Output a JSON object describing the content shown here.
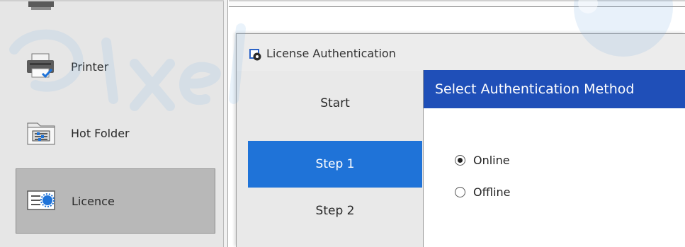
{
  "sidebar": {
    "items": [
      {
        "label": "Printer",
        "icon": "printer-icon"
      },
      {
        "label": "Hot Folder",
        "icon": "hot-folder-icon"
      },
      {
        "label": "Licence",
        "icon": "licence-icon",
        "selected": true
      }
    ]
  },
  "dialog": {
    "title": "License Authentication",
    "title_icon": "license-settings-icon",
    "steps": [
      {
        "label": "Start",
        "active": false
      },
      {
        "label": "Step 1",
        "active": true
      },
      {
        "label": "Step 2",
        "active": false
      }
    ],
    "panel_title": "Select Authentication Method",
    "options": [
      {
        "label": "Online",
        "checked": true
      },
      {
        "label": "Offline",
        "checked": false
      }
    ]
  },
  "colors": {
    "step_active": "#1f73d8",
    "panel_header": "#1f4fb8",
    "sidebar_selected": "#b8b8b8"
  }
}
